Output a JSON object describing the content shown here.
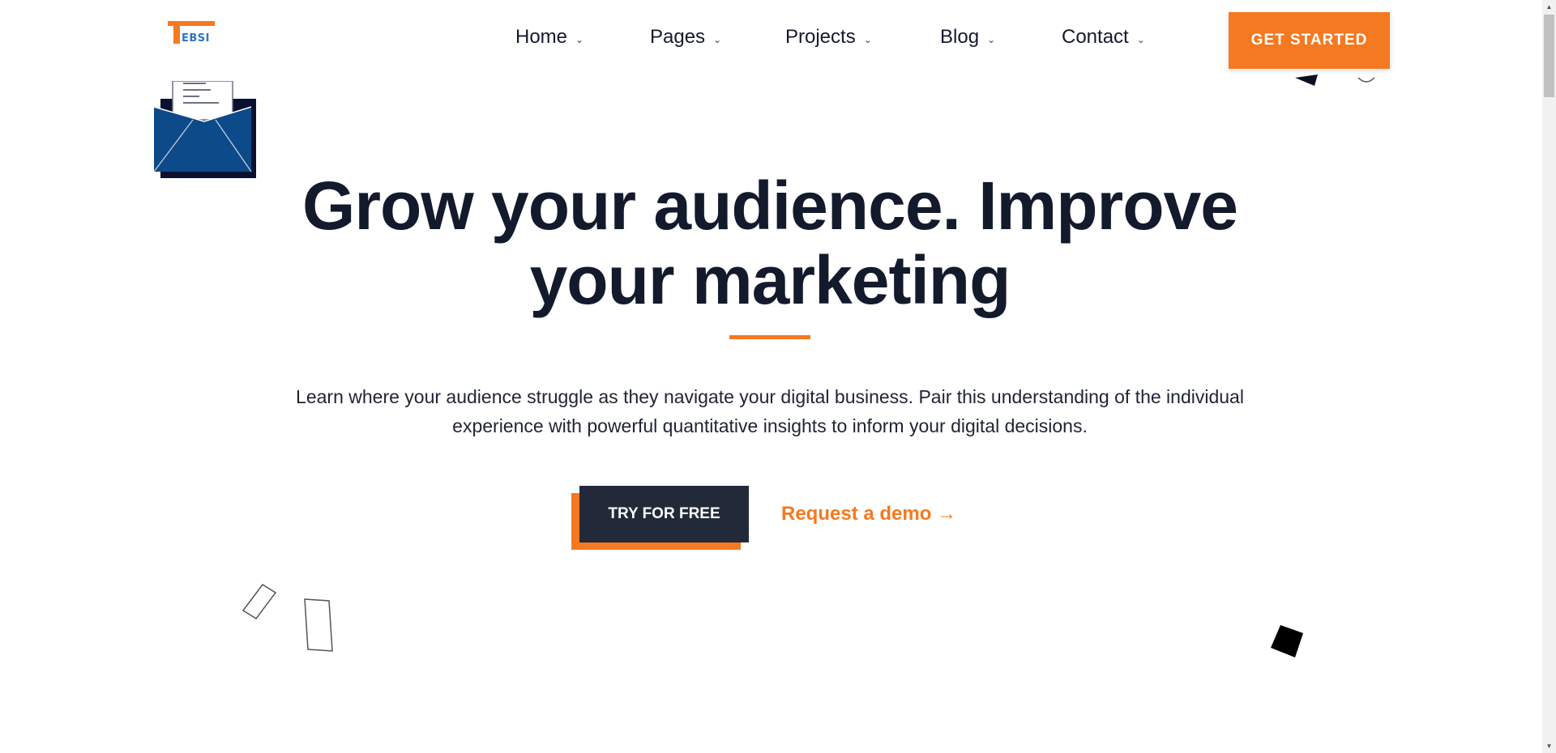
{
  "brand": {
    "logo_text": "EBSI"
  },
  "nav": {
    "items": [
      {
        "label": "Home",
        "chevron": "⌄"
      },
      {
        "label": "Pages",
        "chevron": "⌄"
      },
      {
        "label": "Projects",
        "chevron": "⌄"
      },
      {
        "label": "Blog",
        "chevron": "⌄"
      },
      {
        "label": "Contact",
        "chevron": "⌄"
      }
    ],
    "cta_label": "GET STARTED"
  },
  "hero": {
    "headline_line1": "Grow your audience. Improve",
    "headline_line2": "your marketing",
    "subtext_line1": "Learn where your audience struggle as they navigate your digital business. Pair this understanding of the individual",
    "subtext_line2": "experience with powerful quantitative insights to inform your digital decisions.",
    "primary_button": "TRY FOR FREE",
    "secondary_link": "Request a demo →"
  },
  "colors": {
    "accent": "#f47920",
    "dark": "#131a2c",
    "button_dark": "#222a3a",
    "envelope_blue": "#0d4a8a"
  },
  "icons": [
    "envelope-illustration",
    "chevron-down-icon",
    "arrow-right-icon"
  ]
}
